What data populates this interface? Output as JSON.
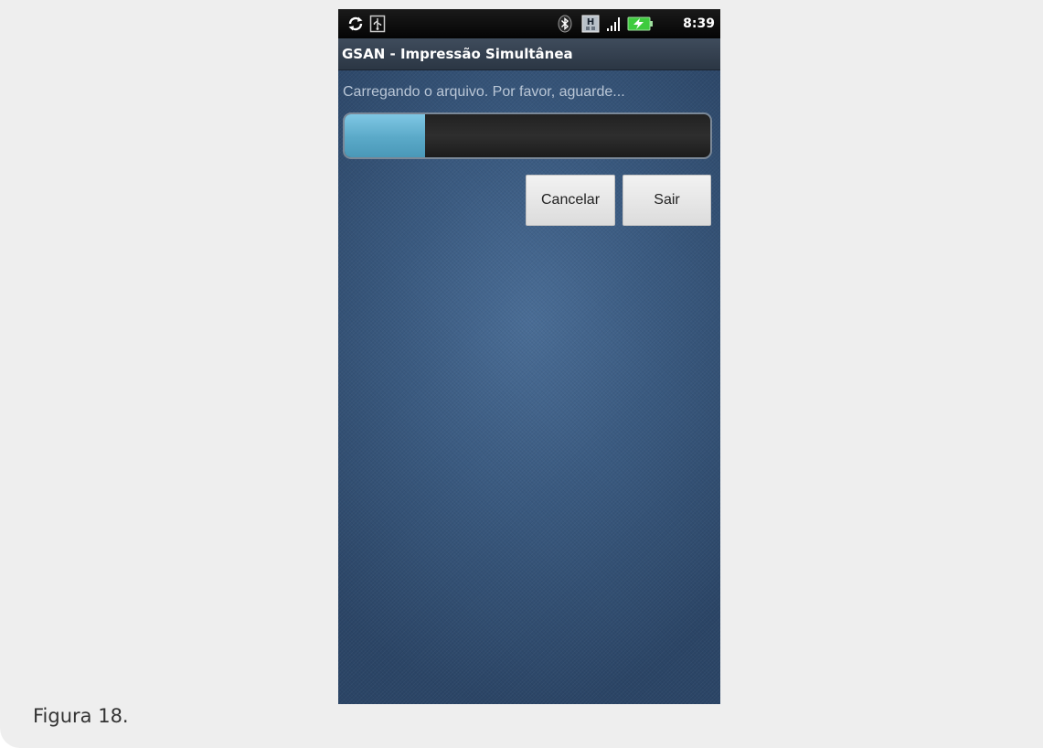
{
  "status_bar": {
    "time": "8:39",
    "icons": [
      "sync-icon",
      "usb-icon",
      "bluetooth-icon",
      "h-network-icon",
      "signal-icon",
      "battery-charging-icon"
    ],
    "h_label": "H"
  },
  "app": {
    "title": "GSAN - Impressão Simultânea",
    "loading_message": "Carregando o arquivo. Por favor, aguarde...",
    "progress_percent": 22
  },
  "buttons": {
    "cancel_label": "Cancelar",
    "exit_label": "Sair"
  },
  "caption": "Figura 18.",
  "colors": {
    "progress_fill": "#5aa9c8",
    "background": "#3a5a80",
    "battery": "#3ecb3e"
  }
}
